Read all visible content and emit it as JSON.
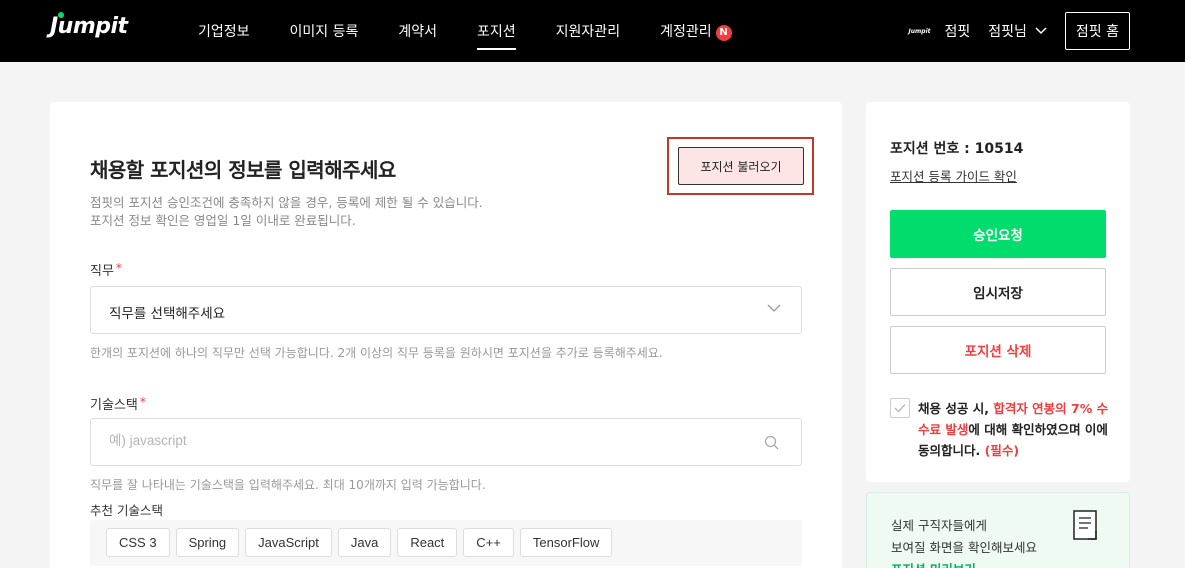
{
  "header": {
    "logo": "Jumpit",
    "nav": [
      "기업정보",
      "이미지 등록",
      "계약서",
      "포지션",
      "지원자관리",
      "계정관리"
    ],
    "nav_badge": "N",
    "mini_logo": "Jumpit",
    "company": "점핏",
    "user": "점핏님",
    "home_button": "점핏 홈",
    "accent_color": "#00dd6d"
  },
  "form": {
    "title": "채용할 포지션의 정보를 입력해주세요",
    "subtitle_1": "점핏의 포지션 승인조건에 충족하지 않을 경우, 등록에 제한 될 수 있습니다.",
    "subtitle_2": "포지션 정보 확인은 영업일 1일 이내로 완료됩니다.",
    "load_button": "포지션 불러오기",
    "job": {
      "label": "직무",
      "required_mark": "*",
      "selected": "직무를 선택해주세요",
      "help": "한개의 포지션에 하나의 직무만 선택 가능합니다. 2개 이상의 직무 등록을 원하시면 포지션을 추가로 등록해주세요."
    },
    "stack": {
      "label": "기술스택",
      "required_mark": "*",
      "placeholder": "예) javascript",
      "help": "직무를 잘 나타내는 기술스택을 입력해주세요. 최대 10개까지 입력 가능합니다.",
      "recommend_label": "추천 기술스택",
      "chips": [
        "CSS 3",
        "Spring",
        "JavaScript",
        "Java",
        "React",
        "C++",
        "TensorFlow"
      ]
    }
  },
  "side": {
    "position_number": "포지션 번호 : 10514",
    "guide_link": "포지션 등록 가이드 확인",
    "approve_button": "승인요청",
    "temp_save_button": "임시저장",
    "delete_button": "포지션 삭제",
    "agree": {
      "part1": "채용 성공 시, ",
      "part2": "합격자 연봉의 7% 수수료 발생",
      "part3": "에 대해 확인하였으며 이에 동의합니다. ",
      "part4": "(필수)"
    }
  },
  "preview": {
    "line1": "실제 구직자들에게",
    "line2": "보여질 화면을 확인해보세요",
    "link": "포지션 미리보기"
  }
}
